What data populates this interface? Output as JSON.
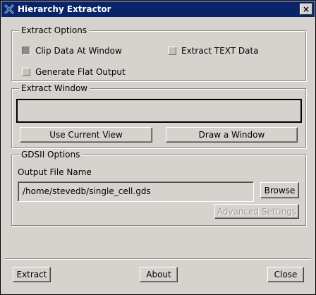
{
  "window": {
    "title": "Hierarchy Extractor",
    "close_glyph": "×"
  },
  "extract_options": {
    "label": "Extract Options",
    "clip_data": {
      "label": "Clip Data At Window",
      "checked": true
    },
    "extract_text": {
      "label": "Extract TEXT Data",
      "checked": false
    },
    "flat_output": {
      "label": "Generate Flat Output",
      "checked": false
    }
  },
  "extract_window": {
    "label": "Extract Window",
    "use_current_view": "Use Current View",
    "draw_window": "Draw a Window"
  },
  "gdsii_options": {
    "label": "GDSII Options",
    "output_file_label": "Output File Name",
    "output_file_value": "/home/stevedb/single_cell.gds",
    "browse": "Browse",
    "advanced_settings": "Advanced Settings"
  },
  "footer": {
    "extract": "Extract",
    "about": "About",
    "close": "Close"
  }
}
